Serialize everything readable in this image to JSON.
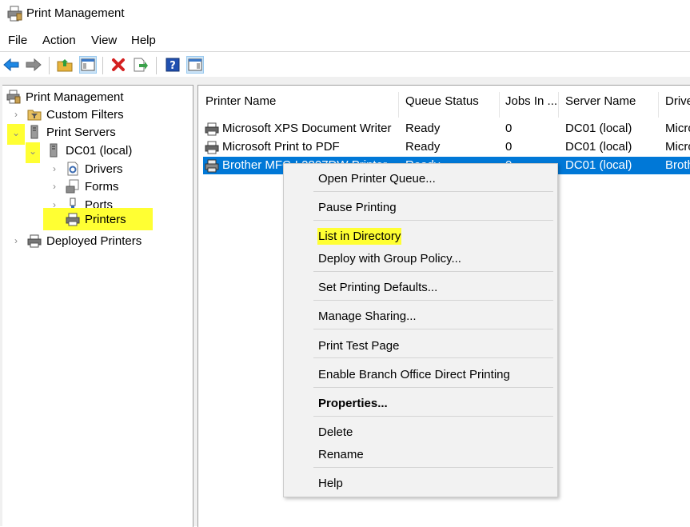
{
  "window": {
    "title": "Print Management"
  },
  "menu": [
    "File",
    "Action",
    "View",
    "Help"
  ],
  "toolbar": {
    "icons": [
      "back-arrow-icon",
      "forward-arrow-icon",
      "up-folder-icon",
      "show-hide-tree-icon",
      "delete-icon",
      "export-list-icon",
      "help-icon",
      "show-hide-action-pane-icon"
    ]
  },
  "tree": {
    "root": "Print Management",
    "items": [
      {
        "label": "Custom Filters"
      },
      {
        "label": "Print Servers"
      },
      {
        "label": "DC01 (local)"
      },
      {
        "label": "Drivers"
      },
      {
        "label": "Forms"
      },
      {
        "label": "Ports"
      },
      {
        "label": "Printers"
      },
      {
        "label": "Deployed Printers"
      }
    ]
  },
  "table": {
    "columns": [
      "Printer Name",
      "Queue Status",
      "Jobs In ...",
      "Server Name",
      "Drive"
    ],
    "rows": [
      {
        "name": "Microsoft XPS Document Writer",
        "status": "Ready",
        "jobs": "0",
        "server": "DC01 (local)",
        "driver": "Micro"
      },
      {
        "name": "Microsoft Print to PDF",
        "status": "Ready",
        "jobs": "0",
        "server": "DC01 (local)",
        "driver": "Micro"
      },
      {
        "name": "Brother MFC-L2807DW Printer",
        "status": "Ready",
        "jobs": "0",
        "server": "DC01 (local)",
        "driver": "Broth"
      }
    ]
  },
  "context_menu": {
    "items": [
      "Open Printer Queue...",
      "Pause Printing",
      "List in Directory",
      "Deploy with Group Policy...",
      "Set Printing Defaults...",
      "Manage Sharing...",
      "Print Test Page",
      "Enable Branch Office Direct Printing",
      "Properties...",
      "Delete",
      "Rename",
      "Help"
    ]
  },
  "colors": {
    "selection": "#0078d7",
    "highlight": "#ffff33"
  }
}
